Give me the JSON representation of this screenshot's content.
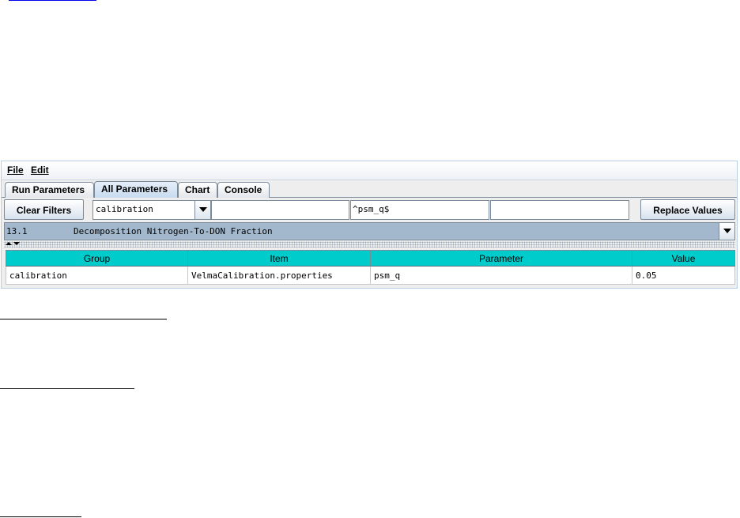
{
  "app": {
    "menus": [
      {
        "label": "File"
      },
      {
        "label": "Edit"
      }
    ],
    "tabs": [
      {
        "label": "Run Parameters",
        "active": false
      },
      {
        "label": "All Parameters",
        "active": true
      },
      {
        "label": "Chart",
        "active": false
      },
      {
        "label": "Console",
        "active": false
      }
    ],
    "toolbar": {
      "clear_filters_label": "Clear Filters",
      "group_filter_value": "calibration",
      "item_filter_value": "",
      "parameter_filter_value": "^psm_q$",
      "value_filter_value": "",
      "replace_values_label": "Replace Values"
    },
    "selected_parameter": {
      "code": "13.1",
      "name": "Decomposition Nitrogen-To-DON Fraction"
    },
    "table": {
      "columns": [
        "Group",
        "Item",
        "Parameter",
        "Value"
      ],
      "rows": [
        [
          "calibration",
          "VelmaCalibration.properties",
          "psm_q",
          "0.05"
        ]
      ]
    }
  },
  "colors": {
    "table_header": "#00cccc",
    "selected_parameter_bg": "#a3b8cc",
    "active_tab": "#c7dbef",
    "link": "#0000ee"
  }
}
